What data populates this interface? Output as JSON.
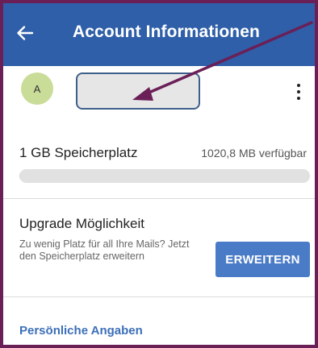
{
  "app_bar": {
    "title": "Account Informationen",
    "back_icon": "arrow-left-icon"
  },
  "profile": {
    "avatar_initial": "A",
    "menu_icon": "more-vertical-icon"
  },
  "storage": {
    "label": "1 GB Speicherplatz",
    "available": "1020,8 MB verfügbar",
    "used_fraction": 0.003
  },
  "upgrade": {
    "title": "Upgrade Möglichkeit",
    "description": "Zu wenig Platz für all Ihre Mails? Jetzt den Speicherplatz erweitern",
    "button_label": "ERWEITERN"
  },
  "personal": {
    "link_label": "Persönliche Angaben"
  },
  "colors": {
    "app_bar": "#2f5fa8",
    "accent": "#4a7bc7",
    "annotation": "#6b1f57",
    "avatar": "#c9dc98"
  }
}
